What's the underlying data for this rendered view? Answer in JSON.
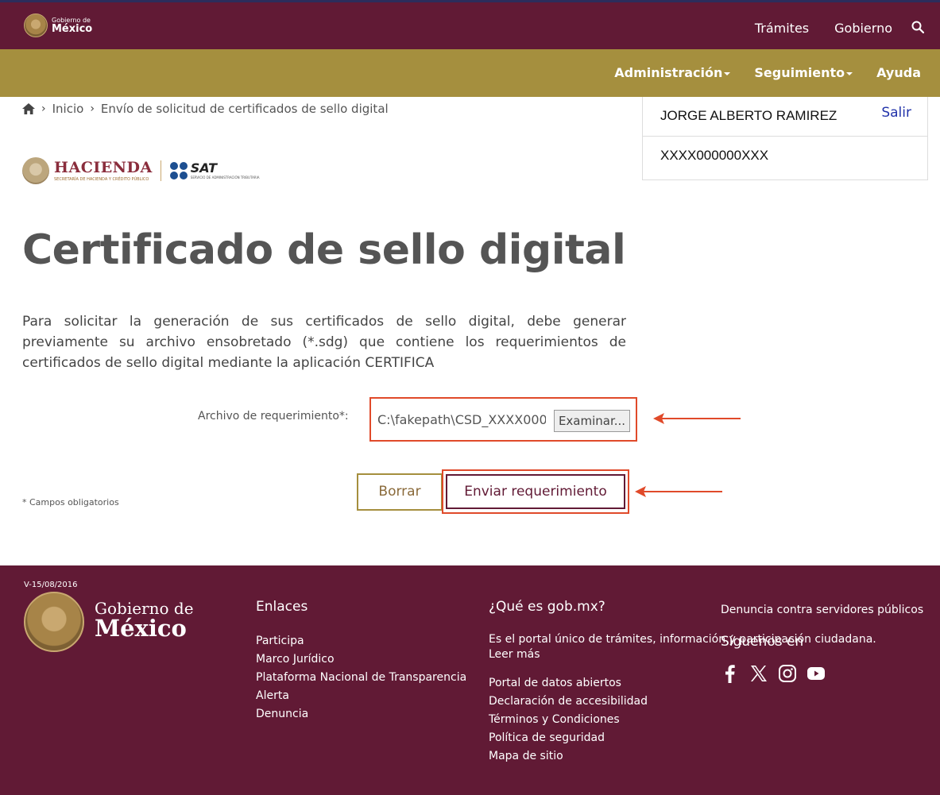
{
  "header": {
    "logo_small": "Gobierno de",
    "logo_big": "México",
    "nav": [
      "Trámites",
      "Gobierno"
    ]
  },
  "subnav": {
    "admin": "Administración",
    "seguimiento": "Seguimiento",
    "ayuda": "Ayuda"
  },
  "breadcrumb": {
    "inicio": "Inicio",
    "current": "Envío de solicitud de certificados de sello digital"
  },
  "user": {
    "name": "JORGE ALBERTO RAMIREZ",
    "logout": "Salir",
    "rfc": "XXXX000000XXX"
  },
  "brand": {
    "hacienda": "HACIENDA",
    "hacienda_sub": "SECRETARÍA DE HACIENDA Y CRÉDITO PÚBLICO",
    "sat": "SAT",
    "sat_sub": "SERVICIO DE ADMINISTRACIÓN TRIBUTARIA"
  },
  "main": {
    "title": "Certificado de sello digital",
    "intro": "Para solicitar la generación de sus certificados de sello digital, debe generar previamente su archivo ensobretado (*.sdg) que contiene los requerimientos de certificados de sello digital mediante la aplicación CERTIFICA",
    "file_label": "Archivo de requerimiento*:",
    "file_value": "C:\\fakepath\\CSD_XXXX000",
    "browse": "Examinar...",
    "clear": "Borrar",
    "send": "Enviar requerimiento",
    "mandatory": "* Campos obligatorios"
  },
  "footer": {
    "version": "V-15/08/2016",
    "gob_small": "Gobierno de",
    "gob_big": "México",
    "links_title": "Enlaces",
    "links": [
      "Participa",
      "Marco Jurídico",
      "Plataforma Nacional de Transparencia",
      "Alerta",
      "Denuncia"
    ],
    "what_title": "¿Qué es gob.mx?",
    "what_text": "Es el portal único de trámites, información y participación ciudadana.",
    "read_more": "Leer más",
    "what_links": [
      "Portal de datos abiertos",
      "Declaración de accesibilidad",
      "Términos y Condiciones",
      "Política de seguridad",
      "Mapa de sitio"
    ],
    "complaint": "Denuncia contra servidores públicos",
    "follow": "Síguenos en",
    "social_icons": [
      "facebook-icon",
      "x-icon",
      "instagram-icon",
      "youtube-icon"
    ]
  },
  "colors": {
    "primary": "#611a35",
    "gold": "#a58f3e",
    "highlight": "#e04a2a"
  }
}
